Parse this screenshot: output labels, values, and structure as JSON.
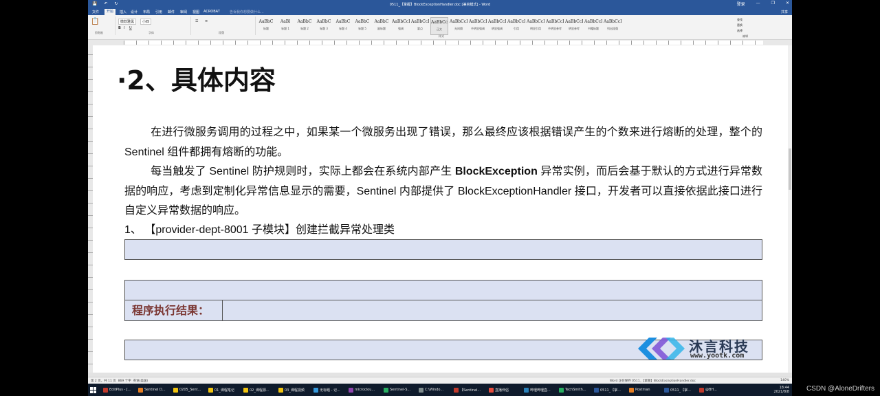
{
  "window": {
    "title": "0511_【掌握】BlockExceptionHandler.doc [兼容模式] - Word",
    "controls": [
      "—",
      "❐",
      "✕"
    ],
    "account": "登录",
    "share": "共享"
  },
  "ribbon": {
    "tabs": [
      "文件",
      "开始",
      "插入",
      "设计",
      "布局",
      "引用",
      "邮件",
      "审阅",
      "视图",
      "ACROBAT"
    ],
    "active_tab": "开始",
    "tell_me": "告诉我你想要做什么...",
    "font_name": "微软雅黑",
    "font_size": "小四",
    "group_labels": [
      "剪贴板",
      "字体",
      "段落",
      "样式",
      "编辑"
    ],
    "styles": [
      {
        "preview": "AaBbC",
        "name": "标题"
      },
      {
        "preview": "AaBl",
        "name": "标题 1"
      },
      {
        "preview": "AaBbC",
        "name": "标题 2"
      },
      {
        "preview": "AaBbC",
        "name": "标题 3"
      },
      {
        "preview": "AaBbC",
        "name": "标题 4"
      },
      {
        "preview": "AaBbC",
        "name": "标题 5"
      },
      {
        "preview": "AaBbC",
        "name": "副标题"
      },
      {
        "preview": "AaBbCcDd",
        "name": "强调"
      },
      {
        "preview": "AaBbCcD",
        "name": "要点"
      },
      {
        "preview": "AaBbCcDc",
        "name": "正文"
      },
      {
        "preview": "AaBbCcDc",
        "name": "无间隔"
      },
      {
        "preview": "AaBbCcDc",
        "name": "不明显强调"
      },
      {
        "preview": "AaBbCcDc",
        "name": "明显强调"
      },
      {
        "preview": "AaBbCcDc",
        "name": "引用"
      },
      {
        "preview": "AaBbCcDc",
        "name": "明显引用"
      },
      {
        "preview": "AaBbCcD",
        "name": "不明显参考"
      },
      {
        "preview": "AaBbCcE",
        "name": "明显参考"
      },
      {
        "preview": "AaBbCcD",
        "name": "书籍标题"
      },
      {
        "preview": "AaBbCcDc",
        "name": "列出段落"
      }
    ],
    "edit_items": [
      "查找",
      "替换",
      "选择"
    ]
  },
  "document": {
    "heading": "·2、具体内容",
    "para1": "在进行微服务调用的过程之中，如果某一个微服务出现了错误，那么最终应该根据错误产生的个数来进行熔断的处理，整个的 Sentinel 组件都拥有熔断的功能。",
    "para2_a": "每当触发了 Sentinel 防护规则时，实际上都会在系统内部产生 ",
    "para2_bold": "BlockException",
    "para2_b": " 异常实例，而后会基于默认的方式进行异常数据的响应，考虑到定制化异常信息显示的需要，Sentinel 内部提供了 BlockExceptionHandler 接口，开发者可以直接依据此接口进行自定义异常数据的响应。",
    "item1": "1、 【provider-dept-8001 子模块】创建拦截异常处理类",
    "result_label": "程序执行结果："
  },
  "logo": {
    "brand": "沐言科技",
    "site": "www.yootk.com"
  },
  "status": {
    "page": "第 2 页，共 11 页",
    "words": "869 个字",
    "lang": "英语(美国)",
    "right": "Word 正在保存 0511_【掌握】BlockExceptionHandler.doc",
    "zoom": "140%"
  },
  "taskbar": {
    "items": [
      "EditPlus - [...",
      "Sentinel D...",
      "0205_Sent...",
      "01_课程笔记",
      "02_课程源...",
      "03_课程视频",
      "无标题 - 记...",
      "microclou...",
      "Sentinel-S...",
      "C:\\Windo...",
      "【Sentinel...",
      "直播伴侣",
      "哔哩哔哩直...",
      "TechSmith...",
      "0511_【掌...",
      "Postman",
      "0511_【掌...",
      "@BH..."
    ],
    "colors": [
      "#c0392b",
      "#e67e22",
      "#f1c40f",
      "#f1c40f",
      "#f1c40f",
      "#f1c40f",
      "#3498db",
      "#8e44ad",
      "#27ae60",
      "#7f8c8d",
      "#c0392b",
      "#e74c3c",
      "#2980b9",
      "#27ae60",
      "#2b579a",
      "#e67e22",
      "#2b579a",
      "#c0392b"
    ],
    "time": "18:44",
    "date": "2021/8/8"
  },
  "watermark": "CSDN @AloneDrifters"
}
